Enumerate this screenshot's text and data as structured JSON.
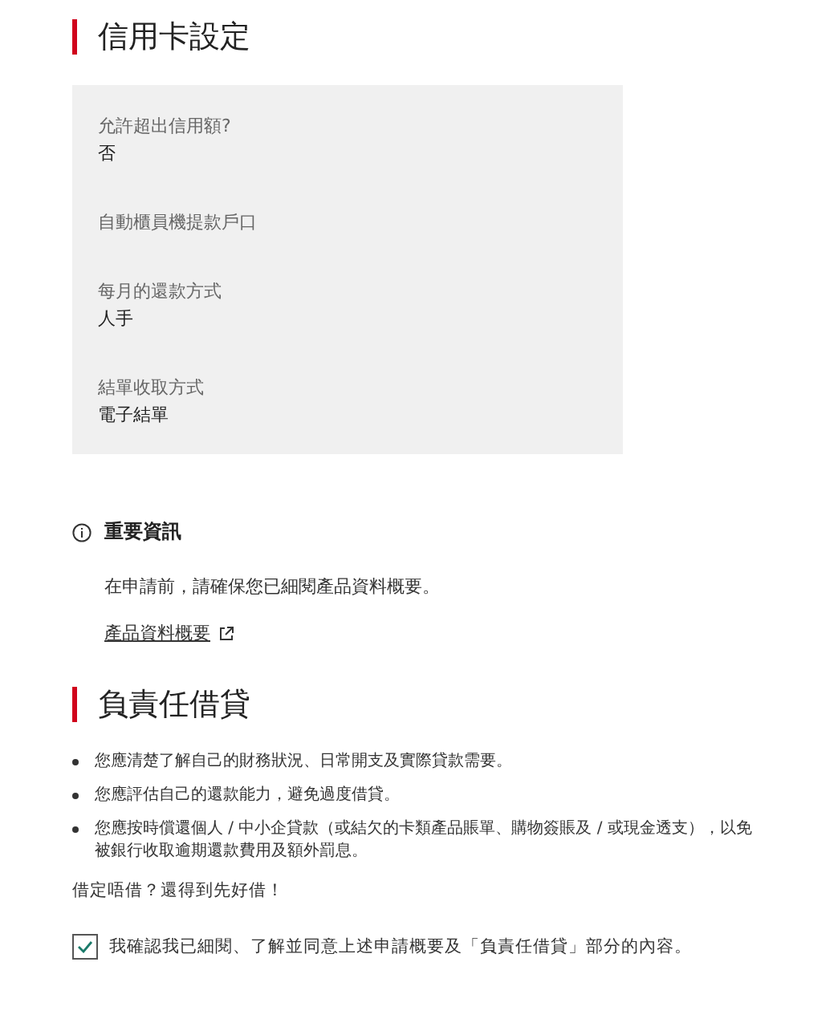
{
  "card_settings": {
    "title": "信用卡設定",
    "fields": [
      {
        "label": "允許超出信用額?",
        "value": "否"
      },
      {
        "label": "自動櫃員機提款戶口"
      },
      {
        "label": "每月的還款方式",
        "value": "人手"
      },
      {
        "label": "結單收取方式",
        "value": "電子結單"
      }
    ]
  },
  "important_info": {
    "title": "重要資訊",
    "text": "在申請前，請確保您已細閱產品資料概要。",
    "link": "產品資料概要"
  },
  "responsible_lending": {
    "title": "負責任借貸",
    "bullets": [
      "您應清楚了解自己的財務狀況、日常開支及實際貸款需要。",
      "您應評估自己的還款能力，避免過度借貸。",
      "您應按時償還個人 / 中小企貸款（或結欠的卡類產品賬單、購物簽賬及 / 或現金透支），以免被銀行收取逾期還款費用及額外罰息。"
    ],
    "slogan": "借定唔借？還得到先好借！",
    "consent": {
      "label": "我確認我已細閱、了解並同意上述申請概要及「負責任借貸」部分的內容。",
      "checked": true
    }
  }
}
